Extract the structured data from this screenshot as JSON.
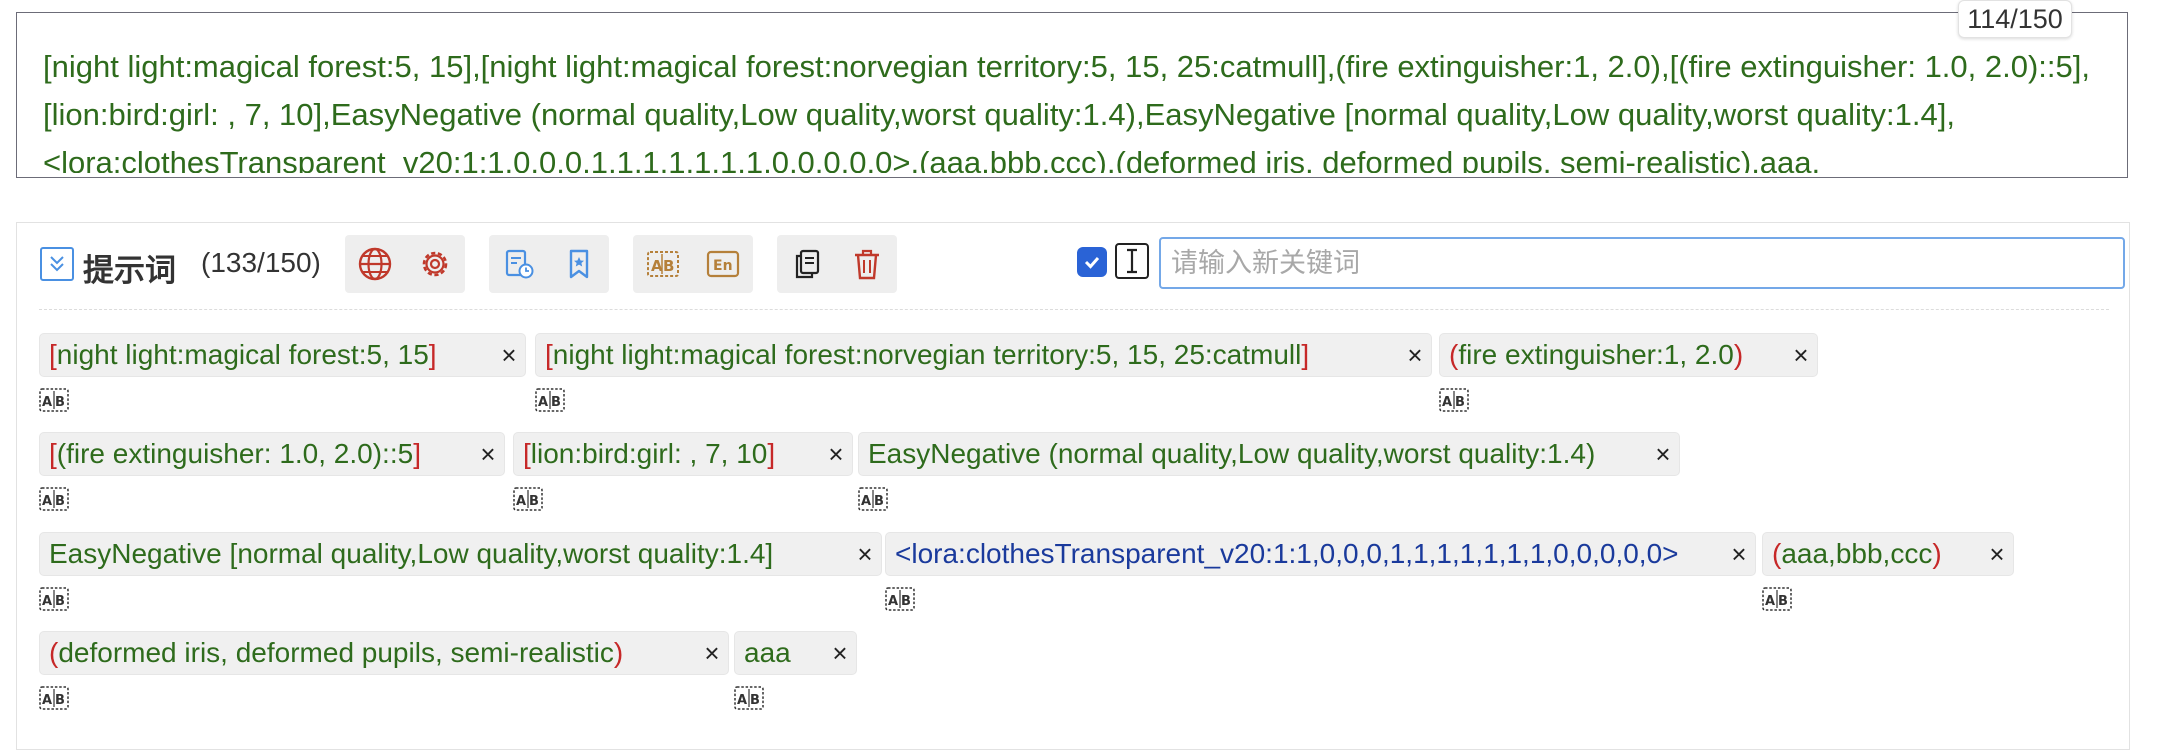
{
  "prompt_textarea": {
    "text": "[night light:magical forest:5, 15],[night light:magical forest:norvegian territory:5, 15, 25:catmull],(fire extinguisher:1, 2.0),[(fire extinguisher: 1.0, 2.0)::5],[lion:bird:girl: , 7, 10],EasyNegative (normal quality,Low quality,worst quality:1.4),EasyNegative [normal quality,Low quality,worst quality:1.4],<lora:clothesTransparent_v20:1:1,0,0,0,1,1,1,1,1,1,1,0,0,0,0,0>,(aaa,bbb,ccc),(deformed iris, deformed pupils, semi-realistic),aaa,",
    "counter": "114/150"
  },
  "panel": {
    "title": "提示词",
    "count": "(133/150)",
    "input_placeholder": "请输入新关键词",
    "toolbar_icons": [
      "globe-icon",
      "gear-icon",
      "history-icon",
      "bookmark-icon",
      "translate-icon",
      "english-icon",
      "copy-icon",
      "trash-icon"
    ],
    "accent_color": "#2a63d6"
  },
  "tags": [
    {
      "open": "[",
      "text": "night light:magical forest:5, 15",
      "close": "]",
      "style": "normal"
    },
    {
      "open": "[",
      "text": "night light:magical forest:norvegian territory:5, 15, 25:catmull",
      "close": "]",
      "style": "normal"
    },
    {
      "open": "(",
      "text": "fire extinguisher:1, 2.0",
      "close": ")",
      "style": "normal"
    },
    {
      "open": "[",
      "text": "(fire extinguisher: 1.0, 2.0)::5",
      "close": "]",
      "style": "normal"
    },
    {
      "open": "[",
      "text": "lion:bird:girl: , 7, 10",
      "close": "]",
      "style": "normal"
    },
    {
      "open": "",
      "text": "EasyNegative (normal quality,Low quality,worst quality:1.4)",
      "close": "",
      "style": "normal"
    },
    {
      "open": "",
      "text": "EasyNegative [normal quality,Low quality,worst quality:1.4]",
      "close": "",
      "style": "normal"
    },
    {
      "open": "",
      "text": "<lora:clothesTransparent_v20:1:1,0,0,0,1,1,1,1,1,1,1,0,0,0,0,0>",
      "close": "",
      "style": "lora"
    },
    {
      "open": "(",
      "text": "aaa,bbb,ccc",
      "close": ")",
      "style": "normal"
    },
    {
      "open": "(",
      "text": "deformed iris, deformed pupils, semi-realistic",
      "close": ")",
      "style": "normal"
    },
    {
      "open": "",
      "text": "aaa",
      "close": "",
      "style": "normal"
    }
  ],
  "tag_close_glyph": "×"
}
